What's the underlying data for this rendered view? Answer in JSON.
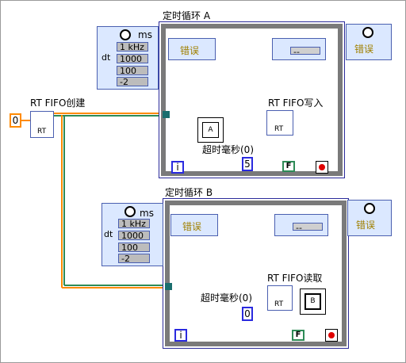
{
  "loop_a": {
    "title": "定时循环 A",
    "unit": "ms",
    "freq": "1 kHz",
    "dt_label": "dt",
    "dt": "1000",
    "offset": "100",
    "priority": "-2",
    "error_label": "错误",
    "dash": "--",
    "iter": "i",
    "stop": "F",
    "timeout_label": "超时毫秒(0)",
    "timeout": "5",
    "node_label": "RT FIFO写入",
    "node_text": "RT",
    "data_label": "A"
  },
  "loop_b": {
    "title": "定时循环 B",
    "unit": "ms",
    "freq": "1 kHz",
    "dt_label": "dt",
    "dt": "1000",
    "offset": "100",
    "priority": "-2",
    "error_label": "错误",
    "dash": "--",
    "iter": "i",
    "stop": "F",
    "timeout_label": "超时毫秒(0)",
    "timeout": "0",
    "node_label": "RT FIFO读取",
    "node_text": "RT",
    "data_label": "B"
  },
  "create": {
    "label": "RT FIFO创建",
    "node_text": "RT",
    "constant": "0"
  },
  "colors": {
    "wire_orange": "#ff8a00",
    "wire_green": "#2e8b57",
    "frame": "#7a7a7a",
    "error_text": "#a08000",
    "node_bg": "#dbe8ff"
  }
}
